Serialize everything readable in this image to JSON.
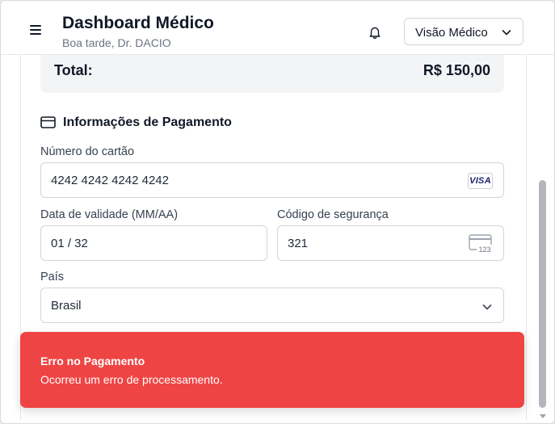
{
  "header": {
    "title": "Dashboard Médico",
    "greeting": "Boa tarde, Dr. DACIO",
    "view_select": "Visão Médico"
  },
  "summary": {
    "total_label": "Total:",
    "total_value": "R$ 150,00"
  },
  "payment": {
    "section_title": "Informações de Pagamento",
    "card_number_label": "Número do cartão",
    "card_number": "4242 4242 4242 4242",
    "card_brand": "VISA",
    "expiry_label": "Data de validade (MM/AA)",
    "expiry": "01 / 32",
    "cvc_label": "Código de segurança",
    "cvc": "321",
    "cvc_icon_text": "123",
    "country_label": "País",
    "country": "Brasil"
  },
  "toast": {
    "title": "Erro no Pagamento",
    "message": "Ocorreu um erro de processamento."
  },
  "colors": {
    "error": "#ef4444",
    "visa_blue": "#1a1f71"
  }
}
